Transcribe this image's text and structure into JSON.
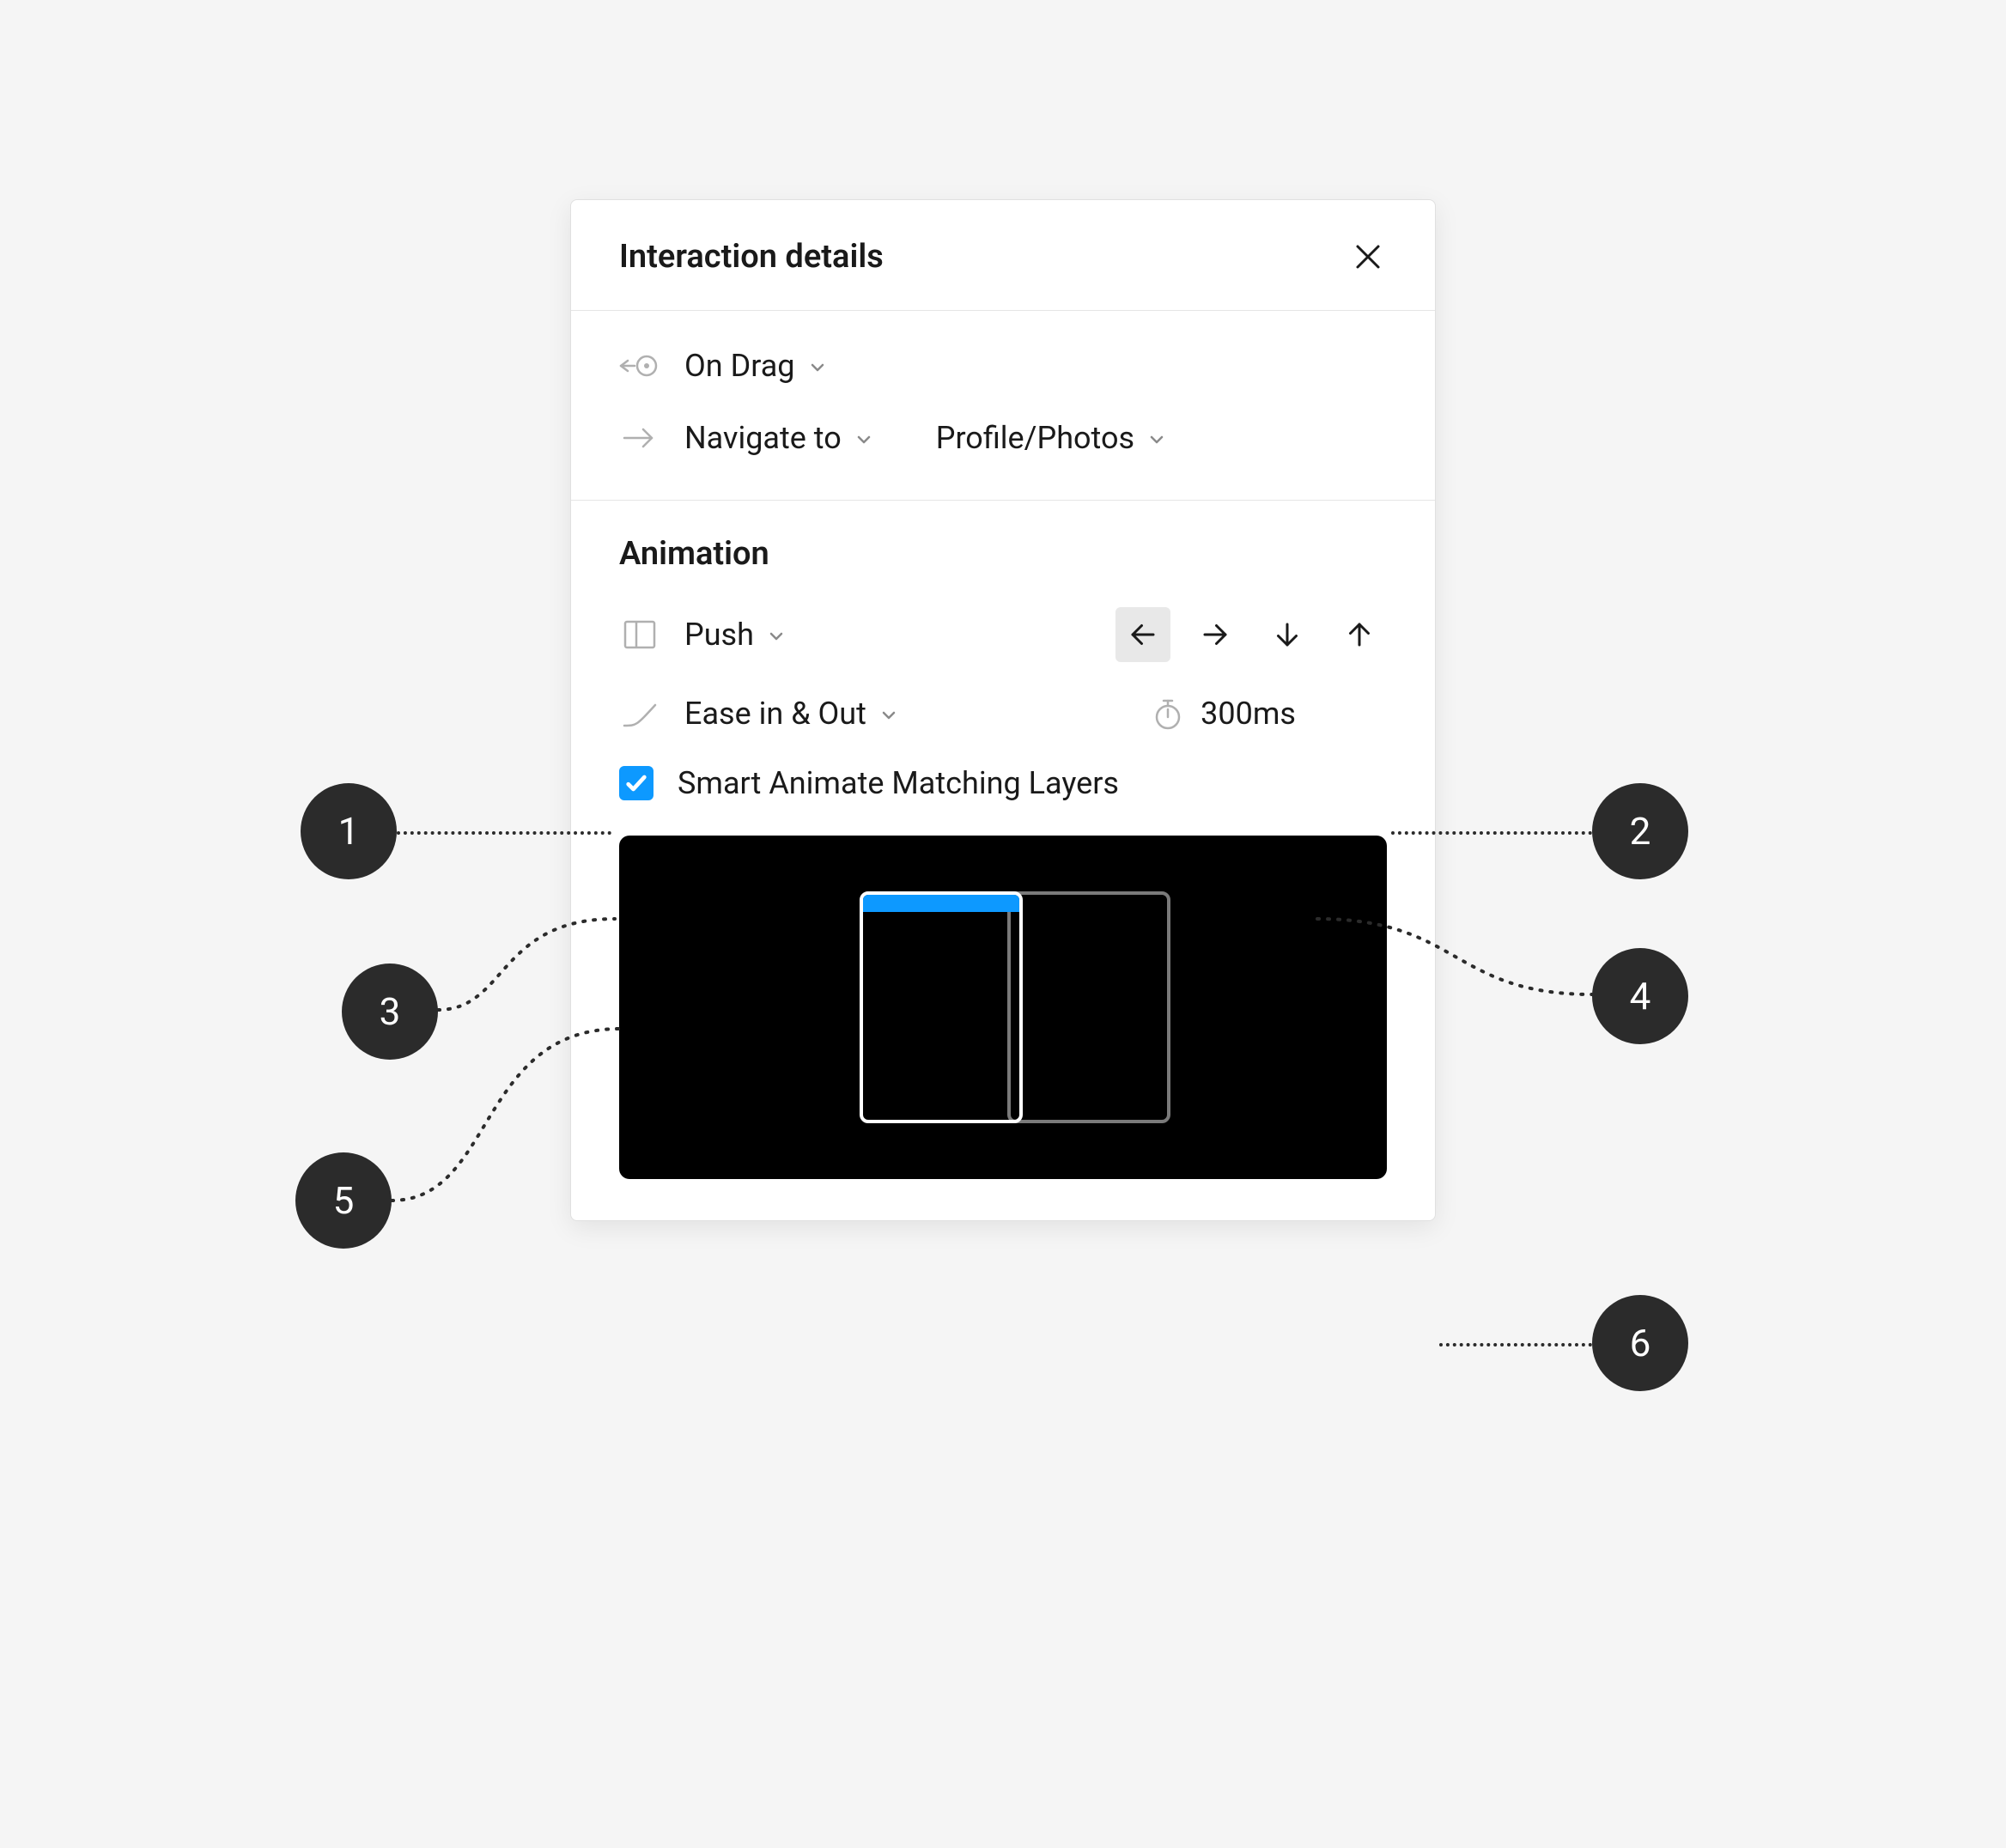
{
  "panel": {
    "title": "Interaction details",
    "trigger": {
      "label": "On Drag"
    },
    "action": {
      "label": "Navigate to",
      "target": "Profile/Photos"
    },
    "animation": {
      "heading": "Animation",
      "type": "Push",
      "direction_selected": "left",
      "easing": "Ease in & Out",
      "duration": "300ms",
      "smart_animate_label": "Smart Animate Matching Layers",
      "smart_animate_checked": true
    }
  },
  "callouts": {
    "b1": "1",
    "b2": "2",
    "b3": "3",
    "b4": "4",
    "b5": "5",
    "b6": "6"
  }
}
